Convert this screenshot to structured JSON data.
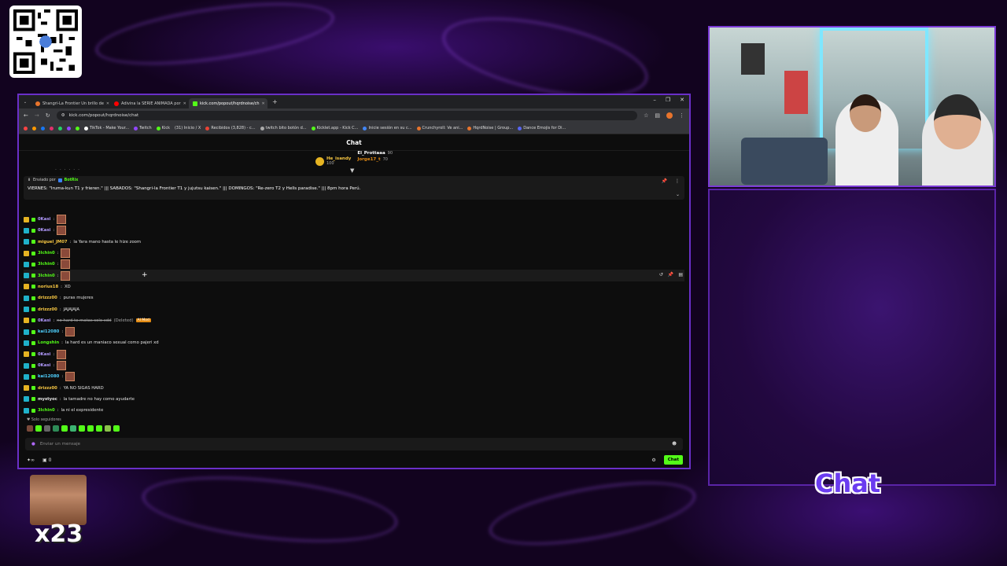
{
  "browser": {
    "tabs": [
      {
        "label": "Shangri-La Frontier Un brillo de",
        "color": "#e8742c"
      },
      {
        "label": "Adivina la SERIE ANIMADA por",
        "color": "#ff0000"
      },
      {
        "label": "kick.com/popout/hqrdnoise/ch",
        "color": "#53fc18"
      }
    ],
    "url": "kick.com/popout/hqrdnoise/chat",
    "bookmarks": [
      "TikTok - Make Your...",
      "Twitch",
      "Kick",
      "(31) Inicio / X",
      "Recibidos (3,828) - c...",
      "twitch bito botón d...",
      "Kicklet.app - Kick C...",
      "Inicie sesión en su c...",
      "Crunchyroll: Ve ani...",
      "HqrdNoise | Group...",
      "Dance Emojis for Di..."
    ]
  },
  "chat": {
    "title": "Chat",
    "gifters": [
      {
        "name": "He_isandy",
        "count": "100"
      },
      {
        "name": "El_Prottaaa",
        "count": "90"
      },
      {
        "name": "Jorge17_t",
        "count": "70"
      }
    ],
    "pinned": {
      "sent_by": "Enviado por",
      "author": "BotRix",
      "text": "VIERNES: \"Iruma-kun T1 y frieren.\" ||| SABADOS: \"Shangri-la Frontier T1 y jujutsu kaisen.\" ||| DOMINGOS: \"Re-zero T2 y Hells paradise.\" ||| 8pm hora Perú."
    },
    "messages": [
      {
        "user": "0Kasi",
        "text": "",
        "color": "#b39bff",
        "emote": true
      },
      {
        "user": "0Kasi",
        "text": "",
        "color": "#b39bff",
        "emote": true
      },
      {
        "user": "miguel_JM07",
        "text": "la Yara mano hasta le hize zoom",
        "color": "#f5c542",
        "emote": false
      },
      {
        "user": "3lchin0",
        "text": "",
        "color": "#53fc18",
        "emote": true
      },
      {
        "user": "3lchin0",
        "text": "",
        "color": "#53fc18",
        "emote": true
      },
      {
        "user": "3lchin0",
        "text": "",
        "color": "#53fc18",
        "emote": true
      },
      {
        "user": "norius18",
        "text": "XD",
        "color": "#f5c542",
        "emote": false
      },
      {
        "user": "drizzz00",
        "text": "puras mujeres",
        "color": "#f5c542",
        "emote": false
      },
      {
        "user": "drizzz00",
        "text": "JAJAJAJA",
        "color": "#f5c542",
        "emote": false
      },
      {
        "user": "0Kasi",
        "text": "no hard te matas solo xdd",
        "color": "#b39bff",
        "emote": false,
        "deleted": "(Deleted)",
        "badge": "AI Mod"
      },
      {
        "user": "kai12080",
        "text": "",
        "color": "#4fd1ff",
        "emote": true
      },
      {
        "user": "Longshin",
        "text": "la hard es un maniaco sexual como pajeri xd",
        "color": "#53fc18",
        "emote": false
      },
      {
        "user": "0Kasi",
        "text": "",
        "color": "#b39bff",
        "emote": true
      },
      {
        "user": "0Kasi",
        "text": "",
        "color": "#b39bff",
        "emote": true
      },
      {
        "user": "kai12080",
        "text": "",
        "color": "#4fd1ff",
        "emote": true
      },
      {
        "user": "drizzz00",
        "text": "YA NO SIGAS HARD",
        "color": "#f5c542",
        "emote": false
      },
      {
        "user": "mystyoc",
        "text": "la tamadre no hay como ayudarte",
        "color": "#e6e6e6",
        "emote": false
      },
      {
        "user": "3lchin0",
        "text": "la ni el expresidente",
        "color": "#53fc18",
        "emote": false
      }
    ],
    "followers_only": "Solo seguidores",
    "input_placeholder": "Enviar un mensaje",
    "bottom_count": "0",
    "send_label": "Chat"
  },
  "overlay": {
    "chat_label": "Chat",
    "multiplier": "x23"
  },
  "colors": {
    "kick_green": "#53fc18",
    "frame_purple": "#7b3ad6"
  }
}
